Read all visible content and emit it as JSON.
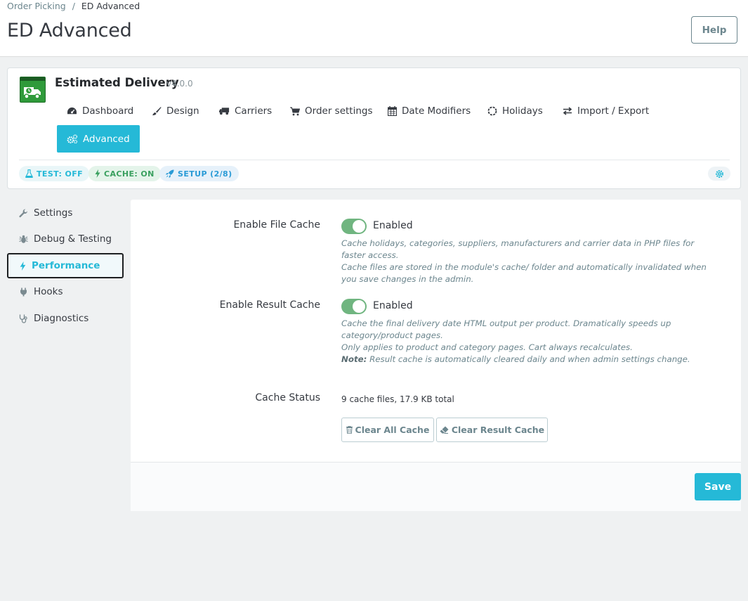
{
  "breadcrumb": {
    "parent": "Order Picking",
    "separator": "/",
    "current": "ED Advanced"
  },
  "page_title": "ED Advanced",
  "help_label": "Help",
  "module": {
    "name": "Estimated Delivery",
    "version": "v4.0.0"
  },
  "tabs": [
    {
      "label": "Dashboard",
      "icon": "dashboard-icon"
    },
    {
      "label": "Design",
      "icon": "brush-icon"
    },
    {
      "label": "Carriers",
      "icon": "truck-icon"
    },
    {
      "label": "Order settings",
      "icon": "cart-icon"
    },
    {
      "label": "Date Modifiers",
      "icon": "calendar-icon"
    },
    {
      "label": "Holidays",
      "icon": "circle-notch-icon"
    },
    {
      "label": "Import / Export",
      "icon": "exchange-icon"
    },
    {
      "label": "Advanced",
      "icon": "cogs-icon",
      "active": true
    }
  ],
  "badges": {
    "test": "TEST: OFF",
    "cache": "CACHE: ON",
    "setup": "SETUP (2/8)"
  },
  "sidebar": {
    "items": [
      {
        "label": "Settings",
        "icon": "wrench-icon"
      },
      {
        "label": "Debug & Testing",
        "icon": "bug-icon"
      },
      {
        "label": "Performance",
        "icon": "bolt-icon",
        "active": true
      },
      {
        "label": "Hooks",
        "icon": "plug-icon"
      },
      {
        "label": "Diagnostics",
        "icon": "stethoscope-icon"
      }
    ]
  },
  "form": {
    "file_cache": {
      "label": "Enable File Cache",
      "state": "Enabled",
      "help_line1": "Cache holidays, categories, suppliers, manufacturers and carrier data in PHP files for faster access.",
      "help_line2": "Cache files are stored in the module's cache/ folder and automatically invalidated when you save changes in the admin."
    },
    "result_cache": {
      "label": "Enable Result Cache",
      "state": "Enabled",
      "help_line1": "Cache the final delivery date HTML output per product. Dramatically speeds up category/product pages.",
      "help_line2": "Only applies to product and category pages. Cart always recalculates.",
      "note_label": "Note:",
      "note_text": " Result cache is automatically cleared daily and when admin settings change."
    },
    "cache_status": {
      "label": "Cache Status",
      "value": "9 cache files, 17.9 KB total",
      "clear_all_label": "Clear All Cache",
      "clear_result_label": "Clear Result Cache"
    }
  },
  "save_label": "Save",
  "colors": {
    "accent": "#25b9d7",
    "switch_on": "#70b580",
    "logo_green": "#2f9a3a"
  }
}
